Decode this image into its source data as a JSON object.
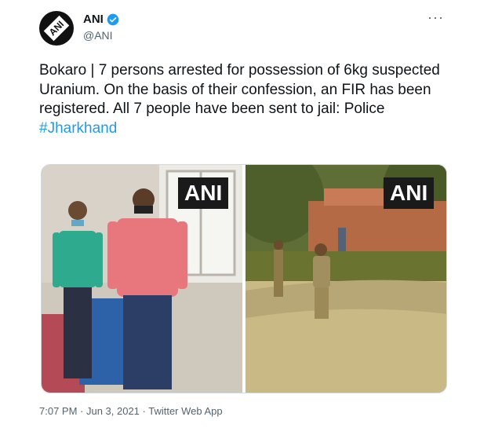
{
  "author": {
    "name": "ANI",
    "handle": "@ANI",
    "avatar_text": "ANI",
    "verified": true
  },
  "tweet": {
    "text": "Bokaro | 7 persons arrested for possession of 6kg suspected Uranium. On the basis of their confession, an FIR has been registered. All 7 people have been sent to jail: Police",
    "hashtag": "#Jharkhand",
    "timestamp": "7:07 PM · Jun 3, 2021 · Twitter Web App"
  },
  "media": {
    "left_watermark": "ANI",
    "right_watermark": "ANI"
  },
  "icons": {
    "more": "more-options-icon",
    "verified": "verified-badge-icon"
  },
  "colors": {
    "link": "#1d9bf0",
    "secondary_text": "#536471",
    "verified": "#1d9bf0"
  }
}
